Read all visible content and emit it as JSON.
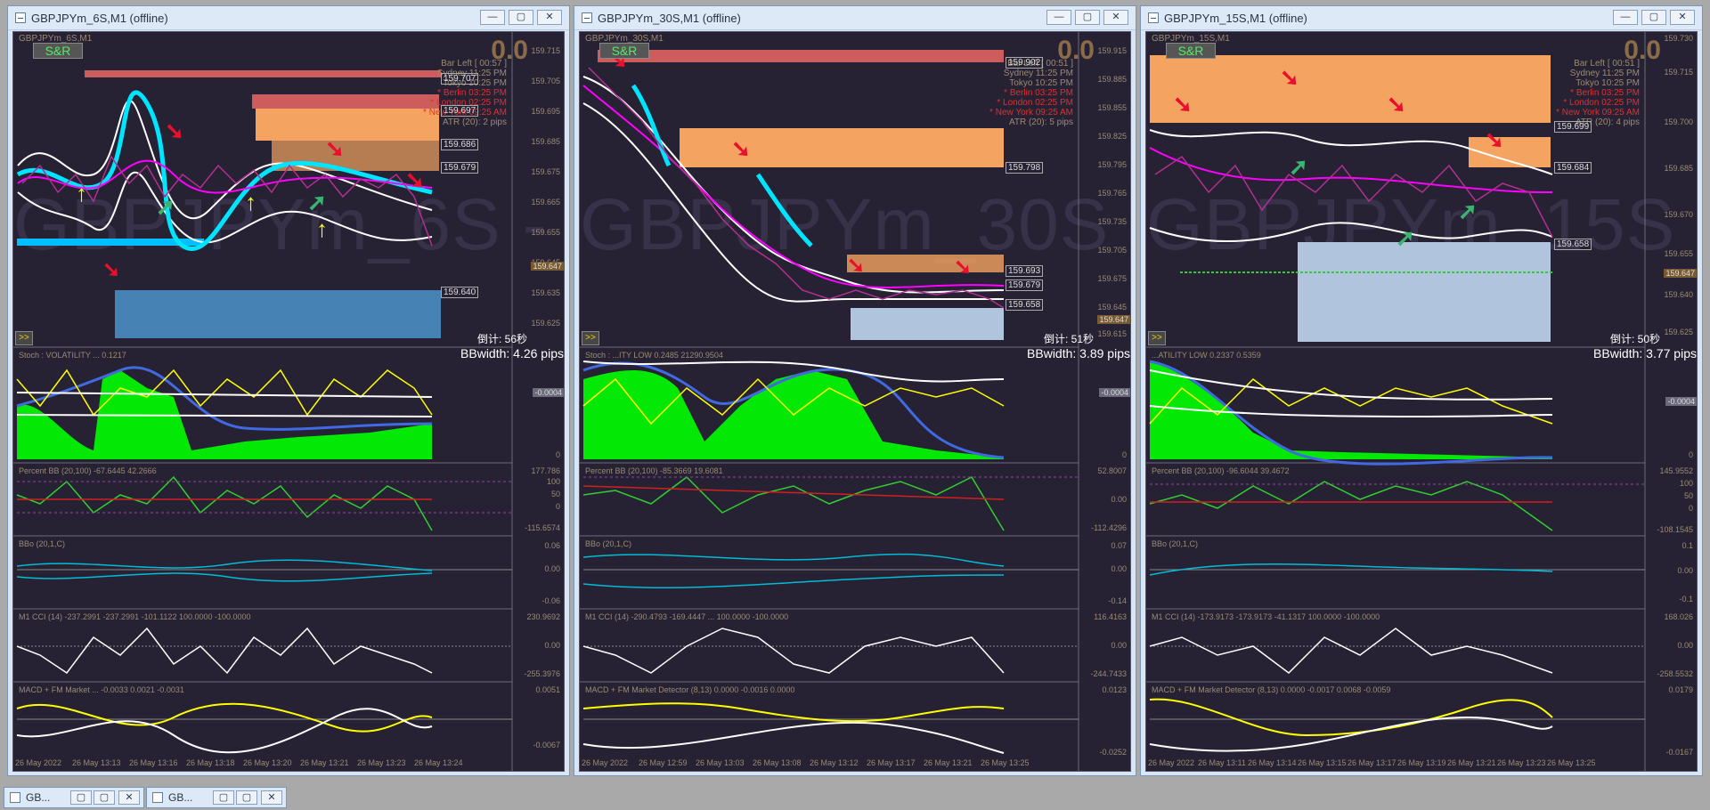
{
  "windows": [
    {
      "title": "GBPJPYm_6S,M1 (offline)",
      "symbol": "GBPJPYm_6S,M1",
      "watermark": "GBPJPYm_6S -",
      "sr_label": "S&R",
      "big_value": "0.0",
      "info": {
        "bar_left": "Bar Left   [ 00:57 ]",
        "city1": "Sydney  11:25 PM",
        "city2": "Tokyo  10:25 PM",
        "berlin": "* Berlin  03:25 PM",
        "london": "* London  02:25 PM",
        "newyork": "* New York  09:25 AM",
        "atr": "ATR (20): 2 pips"
      },
      "price_axis": [
        "159.715",
        "159.705",
        "159.695",
        "159.685",
        "159.675",
        "159.665",
        "159.655",
        "159.645",
        "159.635",
        "159.625"
      ],
      "level_tags": [
        "159.707",
        "159.697",
        "159.686",
        "159.679",
        "159.640"
      ],
      "current_price": "159.647",
      "expand_label": ">>",
      "countdown": "倒计: 56秒",
      "bbwidth": "BBwidth: 4.26 pips",
      "ind1_label": "Stoch : VOLATILITY ... 0.1217",
      "ind1_tag": "-0.0004",
      "ind1_zero": "0",
      "ind2_label": "Percent BB (20,100) -67.6445 42.2666",
      "ind2_axis": [
        "177.786",
        "100",
        "50",
        "0",
        "-115.6574"
      ],
      "ind3_label": "BBo (20,1,C)",
      "ind3_axis": [
        "0.06",
        "0.00",
        "-0.06"
      ],
      "ind4_label": "M1  CCI (14) -237.2991 -237.2991 -101.1122 100.0000 -100.0000",
      "ind4_axis": [
        "230.9692",
        "0.00",
        "-255.3976"
      ],
      "ind5_label": "MACD + FM Market ... -0.0033 0.0021 -0.0031",
      "ind5_axis": [
        "0.0051",
        "-0.0067"
      ],
      "time_axis": [
        "26 May 2022",
        "26 May 13:13",
        "26 May 13:16",
        "26 May 13:18",
        "26 May 13:20",
        "26 May 13:21",
        "26 May 13:23",
        "26 May 13:24"
      ]
    },
    {
      "title": "GBPJPYm_30S,M1 (offline)",
      "symbol": "GBPJPYm_30S,M1",
      "watermark": "GBPJPYm_30S -",
      "sr_label": "S&R",
      "big_value": "0.0",
      "info": {
        "bar_left": "Bar Left   [ 00:51 ]",
        "city1": "Sydney  11:25 PM",
        "city2": "Tokyo  10:25 PM",
        "berlin": "* Berlin  03:25 PM",
        "london": "* London  02:25 PM",
        "newyork": "* New York  09:25 AM",
        "atr": "ATR (20): 5 pips"
      },
      "price_axis": [
        "159.915",
        "159.885",
        "159.855",
        "159.825",
        "159.795",
        "159.765",
        "159.735",
        "159.705",
        "159.675",
        "159.645",
        "159.615"
      ],
      "level_tags": [
        "159.902",
        "159.798",
        "159.693",
        "159.679",
        "159.658"
      ],
      "current_price": "159.647",
      "expand_label": ">>",
      "countdown": "倒计: 51秒",
      "bbwidth": "BBwidth: 3.89 pips",
      "ind1_label": "Stoch : ...ITY LOW 0.2485 21290.9504",
      "ind1_tag": "-0.0004",
      "ind1_zero": "0",
      "ind2_label": "Percent BB (20,100) -85.3669 19.6081",
      "ind2_axis": [
        "52.8007",
        "0.00",
        "-112.4296"
      ],
      "ind3_label": "BBo (20,1,C)",
      "ind3_axis": [
        "0.07",
        "0.00",
        "-0.14"
      ],
      "ind4_label": "M1  CCI (14) -290.4793 -169.4447 ... 100.0000 -100.0000",
      "ind4_axis": [
        "116.4163",
        "0.00",
        "-244.7433"
      ],
      "ind5_label": "MACD + FM Market Detector (8,13) 0.0000 -0.0016 0.0000",
      "ind5_axis": [
        "0.0123",
        "-0.0252"
      ],
      "time_axis": [
        "26 May 2022",
        "26 May 12:59",
        "26 May 13:03",
        "26 May 13:08",
        "26 May 13:12",
        "26 May 13:17",
        "26 May 13:21",
        "26 May 13:25"
      ]
    },
    {
      "title": "GBPJPYm_15S,M1 (offline)",
      "symbol": "GBPJPYm_15S,M1",
      "watermark": "GBPJPYm_15S -",
      "sr_label": "S&R",
      "big_value": "0.0",
      "info": {
        "bar_left": "Bar Left   [ 00:51 ]",
        "city1": "Sydney  11:25 PM",
        "city2": "Tokyo  10:25 PM",
        "berlin": "* Berlin  03:25 PM",
        "london": "* London  02:25 PM",
        "newyork": "* New York  09:25 AM",
        "atr": "ATR (20): 4 pips"
      },
      "price_axis": [
        "159.730",
        "159.715",
        "159.700",
        "159.685",
        "159.670",
        "159.655",
        "159.640",
        "159.625"
      ],
      "level_tags": [
        "159.699",
        "159.684",
        "159.658"
      ],
      "current_price": "159.647",
      "expand_label": ">>",
      "countdown": "倒计: 50秒",
      "bbwidth": "BBwidth: 3.77 pips",
      "ind1_label": "...ATILITY LOW 0.2337 0.5359",
      "ind1_tag": "-0.0004",
      "ind1_zero": "0",
      "ind2_label": "Percent BB (20,100) -96.6044 39.4672",
      "ind2_axis": [
        "145.9552",
        "100",
        "50",
        "0",
        "-108.1545"
      ],
      "ind3_label": "BBo (20,1,C)",
      "ind3_axis": [
        "0.1",
        "0.00",
        "-0.1"
      ],
      "ind4_label": "M1  CCI (14) -173.9173 -173.9173 -41.1317 100.0000 -100.0000",
      "ind4_axis": [
        "168.026",
        "0.00",
        "-258.5532"
      ],
      "ind5_label": "MACD + FM Market Detector (8,13) 0.0000 -0.0017 0.0068 -0.0059",
      "ind5_axis": [
        "0.0179",
        "-0.0167"
      ],
      "time_axis": [
        "26 May 2022",
        "26 May 13:11",
        "26 May 13:14",
        "26 May 13:15",
        "26 May 13:17",
        "26 May 13:19",
        "26 May 13:21",
        "26 May 13:23",
        "26 May 13:25"
      ]
    }
  ],
  "minimized": [
    {
      "title": "GB..."
    },
    {
      "title": "GB..."
    }
  ],
  "buttons": {
    "min": "—",
    "max": "▢",
    "close": "✕"
  },
  "colors": {
    "background": "#262233",
    "green": "#00ff00",
    "yellow": "#ffff00",
    "cyan": "#00e5ff",
    "orange_zone": "#f4a460",
    "blue_zone": "#4682b4",
    "red_zone": "#cd5c5c"
  }
}
